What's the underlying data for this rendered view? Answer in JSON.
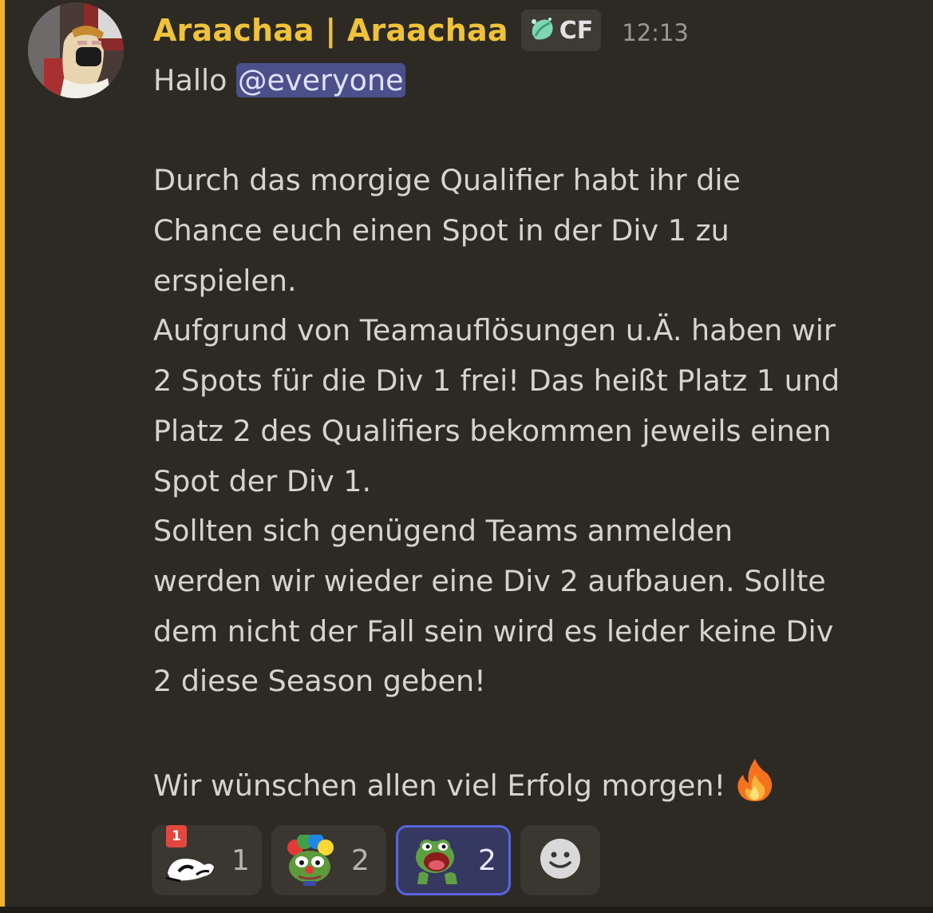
{
  "message": {
    "username": "Araachaa | Araachaa",
    "tag": {
      "text": "CF",
      "icon": "leaf-badge-icon",
      "color": "#e2e2e2"
    },
    "timestamp": "12:13",
    "username_color": "#f0c23a",
    "highlight_color": "#f0b232",
    "greeting": "Hallo",
    "mention": "@everyone",
    "lines": [
      "",
      "Durch das morgige Qualifier habt ihr die",
      "Chance euch einen Spot in der Div 1 zu",
      "erspielen.",
      "Aufgrund von Teamauflösungen u.Ä. haben wir",
      "2 Spots für die Div 1 frei! Das heißt Platz 1 und",
      "Platz 2 des Qualifiers bekommen jeweils einen",
      "Spot der Div 1.",
      "Sollten sich genügend Teams anmelden",
      "werden wir wieder eine Div 2 aufbauen. Sollte",
      "dem nicht der Fall sein wird es leider keine Div",
      "2 diese Season geben!",
      ""
    ],
    "closing": "Wir wünschen allen viel Erfolg morgen!",
    "closing_emoji": "fire-emoji",
    "reactions": [
      {
        "emoji": "number-one-seal-emoji",
        "badge": "1",
        "count": "1",
        "active": false
      },
      {
        "emoji": "clown-frog-emoji",
        "count": "2",
        "active": false
      },
      {
        "emoji": "shouting-frog-emoji",
        "count": "2",
        "active": true
      },
      {
        "emoji": "add-reaction-icon",
        "active": false
      }
    ]
  }
}
